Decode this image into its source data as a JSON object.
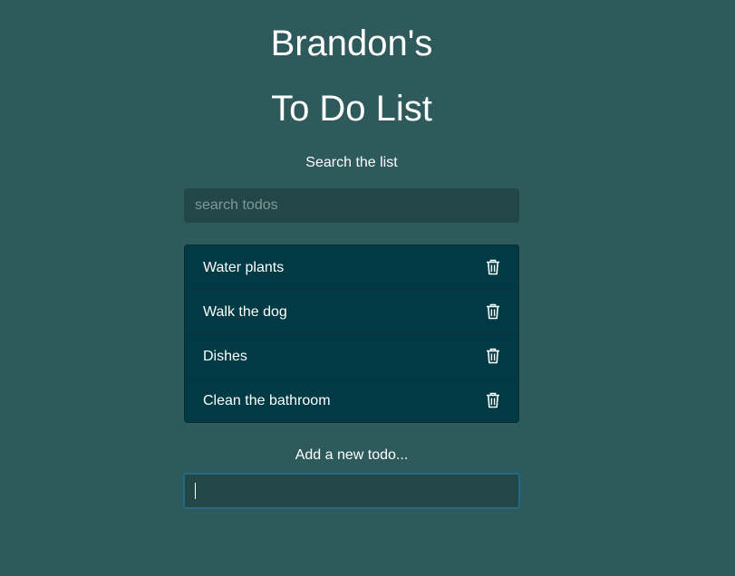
{
  "header": {
    "title_line1": "Brandon's",
    "title_line2": "To Do List"
  },
  "search": {
    "label": "Search the list",
    "placeholder": "search todos",
    "value": ""
  },
  "todos": [
    {
      "text": "Water plants",
      "delete_icon": "trash-icon"
    },
    {
      "text": "Walk the dog",
      "delete_icon": "trash-icon"
    },
    {
      "text": "Dishes",
      "delete_icon": "trash-icon"
    },
    {
      "text": "Clean the bathroom",
      "delete_icon": "trash-icon"
    }
  ],
  "add": {
    "label": "Add a new todo...",
    "value": "",
    "placeholder": ""
  },
  "colors": {
    "background": "#2e5a5b",
    "list_background": "#003a44",
    "input_background": "#234747",
    "focus_border": "#1f6b86"
  }
}
